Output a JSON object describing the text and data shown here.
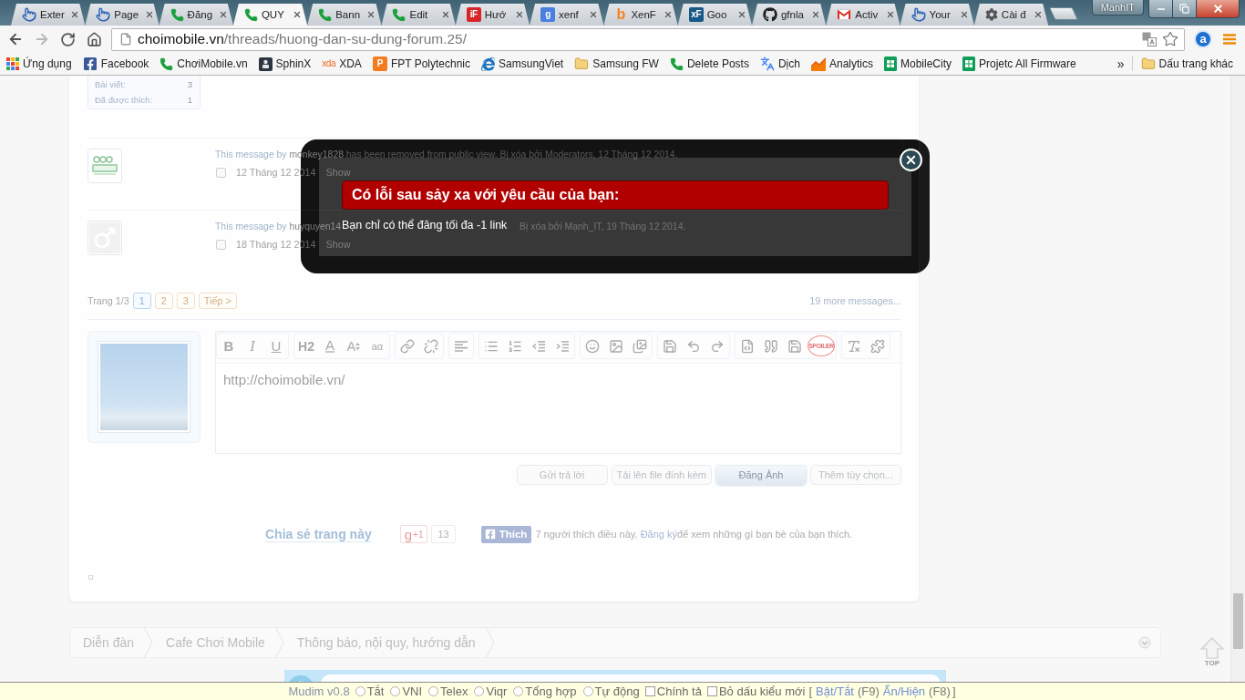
{
  "browser": {
    "tabs": [
      {
        "title": "Exter",
        "selected": false,
        "favicon": {
          "kind": "pointer"
        }
      },
      {
        "title": "Page",
        "selected": false,
        "favicon": {
          "kind": "pointer"
        }
      },
      {
        "title": "Đăng",
        "selected": false,
        "favicon": {
          "kind": "phone"
        }
      },
      {
        "title": "QUY",
        "selected": true,
        "favicon": {
          "kind": "phone"
        }
      },
      {
        "title": "Bann",
        "selected": false,
        "favicon": {
          "kind": "phone"
        }
      },
      {
        "title": "Edit",
        "selected": false,
        "favicon": {
          "kind": "phone"
        }
      },
      {
        "title": "Hướ",
        "selected": false,
        "favicon": {
          "kind": "tile",
          "text": "iF",
          "color": "#d9252a"
        }
      },
      {
        "title": "xenf",
        "selected": false,
        "favicon": {
          "kind": "tile",
          "text": "g",
          "color": "#4a7fe0"
        }
      },
      {
        "title": "XenF",
        "selected": false,
        "favicon": {
          "kind": "letter",
          "text": "b",
          "color": "#f58220"
        }
      },
      {
        "title": "Goo",
        "selected": false,
        "favicon": {
          "kind": "tile",
          "text": "xF",
          "color": "#185886"
        }
      },
      {
        "title": "gfnla",
        "selected": false,
        "favicon": {
          "kind": "github"
        }
      },
      {
        "title": "Activ",
        "selected": false,
        "favicon": {
          "kind": "gmail"
        }
      },
      {
        "title": "Your",
        "selected": false,
        "favicon": {
          "kind": "pointer"
        }
      },
      {
        "title": "Cài đ",
        "selected": false,
        "favicon": {
          "kind": "gear"
        }
      }
    ],
    "profile": "ManhIT",
    "address": {
      "host": "choimobile.vn",
      "path": "/threads/huong-dan-su-dung-forum.25/"
    },
    "extension": "a",
    "bookmarks": [
      {
        "label": "Ứng dụng",
        "icon": {
          "kind": "apps"
        }
      },
      {
        "label": "Facebook",
        "icon": {
          "kind": "facebook"
        }
      },
      {
        "label": "ChơiMobile.vn",
        "icon": {
          "kind": "phone"
        }
      },
      {
        "label": "SphinX",
        "icon": {
          "kind": "sphinx"
        }
      },
      {
        "label": "XDA",
        "icon": {
          "kind": "text",
          "text": "xda"
        }
      },
      {
        "label": "FPT Polytechnic",
        "icon": {
          "kind": "tile",
          "text": "P",
          "color": "#f47b20"
        }
      },
      {
        "label": "SamsungViet",
        "icon": {
          "kind": "ie"
        }
      },
      {
        "label": "Samsung FW",
        "icon": {
          "kind": "folder"
        }
      },
      {
        "label": "Delete Posts",
        "icon": {
          "kind": "phone"
        }
      },
      {
        "label": "Dịch",
        "icon": {
          "kind": "translate"
        }
      },
      {
        "label": "Analytics",
        "icon": {
          "kind": "analytics"
        }
      },
      {
        "label": "MobileCity",
        "icon": {
          "kind": "sheet"
        }
      },
      {
        "label": "Projetc All Firmware",
        "icon": {
          "kind": "sheet"
        }
      }
    ],
    "overflow": "»",
    "other_bookmarks": "Dấu trang khác"
  },
  "page": {
    "poster_stats": [
      {
        "label": "Bài viết:",
        "value": "3"
      },
      {
        "label": "Đã được thích:",
        "value": "1"
      }
    ],
    "deleted_messages": [
      {
        "kind": "logo-avatar",
        "prefix": "This message by",
        "username": "monkey1828",
        "details": "has been removed from public view. Bị xóa bởi Moderators, 12 Tháng 12 2014.",
        "checked": false,
        "date": "12 Tháng 12 2014",
        "show": "Show"
      },
      {
        "kind": "default-avatar",
        "prefix": "This message by",
        "username": "huyquyen14",
        "trailing_text": "Bị xóa bởi Mạnh_IT, 19 Tháng 12 2014.",
        "checked": false,
        "date": "18 Tháng 12 2014",
        "show": "Show"
      }
    ],
    "pagination": {
      "label": "Trang 1/3",
      "pages": [
        {
          "label": "1",
          "selected": true
        },
        {
          "label": "2",
          "selected": false
        },
        {
          "label": "3",
          "selected": false
        }
      ],
      "next": "Tiếp >",
      "more": "19 more messages..."
    },
    "editor": {
      "toolbar": [
        [
          {
            "kind": "bold",
            "label": "B"
          },
          {
            "kind": "italic",
            "label": "I"
          },
          {
            "kind": "underline",
            "label": "U"
          }
        ],
        [
          {
            "kind": "heading",
            "label": "H2"
          },
          {
            "kind": "font-color",
            "label": "A"
          },
          {
            "kind": "font-size",
            "label": "A"
          },
          {
            "kind": "font-family",
            "label": "aα"
          }
        ],
        [
          {
            "kind": "link"
          },
          {
            "kind": "unlink"
          }
        ],
        [
          {
            "kind": "align-left"
          }
        ],
        [
          {
            "kind": "bullet-list"
          },
          {
            "kind": "numbered-list"
          },
          {
            "kind": "outdent"
          },
          {
            "kind": "indent"
          }
        ],
        [
          {
            "kind": "smiley"
          },
          {
            "kind": "image"
          },
          {
            "kind": "media"
          }
        ],
        [
          {
            "kind": "draft"
          },
          {
            "kind": "undo"
          },
          {
            "kind": "redo"
          }
        ],
        [
          {
            "kind": "code"
          },
          {
            "kind": "quote"
          },
          {
            "kind": "draft"
          },
          {
            "kind": "spoiler",
            "label": "SPOILER"
          }
        ],
        [
          {
            "kind": "remove-format"
          },
          {
            "kind": "plugin"
          }
        ]
      ],
      "value": "http://choimobile.vn/"
    },
    "buttons": [
      {
        "label": "Gửi trả lời",
        "highlighted": false
      },
      {
        "label": "Tải lên file đính kèm",
        "highlighted": false
      },
      {
        "label": "Đăng Ảnh",
        "highlighted": true
      },
      {
        "label": "Thêm tùy chọn...",
        "highlighted": false
      }
    ],
    "share": {
      "title": "Chia sẻ trang này",
      "gplus_logo": "g",
      "gplus_label": "+1",
      "gplus_count": "13",
      "like": "Thích",
      "like_text": "7 người thích điều này.",
      "signup": "Đăng ký",
      "signup_text": "để xem những gì bạn bè của bạn thích."
    },
    "breadcrumb": [
      "Diễn đàn",
      "Cafe Chơi Mobile",
      "Thông báo, nội quy, hướng dẫn"
    ]
  },
  "modal": {
    "heading": "Có lỗi sau sảy xa với yêu cầu của bạn:",
    "message": "Bạn chỉ có thể đăng tối đa -1 link"
  },
  "scroll_top": "TOP",
  "mudim": {
    "title": "Mudim v0.8",
    "modes": [
      {
        "label": "Tắt",
        "selected": false
      },
      {
        "label": "VNI",
        "selected": false
      },
      {
        "label": "Telex",
        "selected": false
      },
      {
        "label": "Viqr",
        "selected": false
      },
      {
        "label": "Tổng hợp",
        "selected": false
      },
      {
        "label": "Tự động",
        "selected": false
      }
    ],
    "options": [
      {
        "label": "Chính tả",
        "checked": false
      },
      {
        "label": "Bỏ dấu kiểu mới",
        "checked": false
      }
    ],
    "open_bracket": "[",
    "shortcuts": [
      {
        "link": "Bật/Tắt",
        "key": "(F9)"
      },
      {
        "link": "Ẩn/Hiện",
        "key": "(F8)"
      }
    ],
    "close_bracket": "]"
  }
}
